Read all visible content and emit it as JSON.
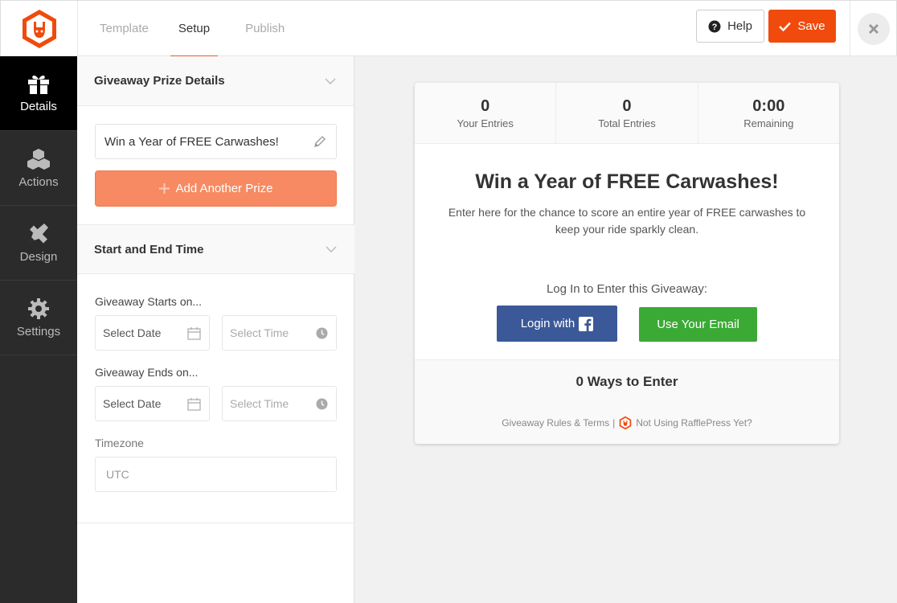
{
  "colors": {
    "brand": "#f04a0d",
    "dark_nav": "#2b2b2b",
    "facebook": "#3b5998",
    "email_green": "#3aaa35",
    "add_prize": "#f78a62"
  },
  "header": {
    "tabs": [
      {
        "label": "Template",
        "active": false
      },
      {
        "label": "Setup",
        "active": true
      },
      {
        "label": "Publish",
        "active": false
      }
    ],
    "help_label": "Help",
    "save_label": "Save"
  },
  "sidebar": {
    "items": [
      {
        "label": "Details",
        "icon": "gift-icon",
        "active": true
      },
      {
        "label": "Actions",
        "icon": "cubes-icon",
        "active": false
      },
      {
        "label": "Design",
        "icon": "pencil-ruler-icon",
        "active": false
      },
      {
        "label": "Settings",
        "icon": "gear-icon",
        "active": false
      }
    ]
  },
  "panel": {
    "prize_section_title": "Giveaway Prize Details",
    "prize_name": "Win a Year of FREE Carwashes!",
    "add_prize_label": "Add Another Prize",
    "time_section_title": "Start and End Time",
    "starts_label": "Giveaway Starts on...",
    "ends_label": "Giveaway Ends on...",
    "date_placeholder": "Select Date",
    "time_placeholder": "Select Time",
    "timezone_label": "Timezone",
    "timezone_value": "UTC"
  },
  "preview": {
    "stats": [
      {
        "value": "0",
        "label": "Your Entries"
      },
      {
        "value": "0",
        "label": "Total Entries"
      },
      {
        "value": "0:00",
        "label": "Remaining"
      }
    ],
    "title": "Win a Year of FREE Carwashes!",
    "description": "Enter here for the chance to score an entire year of FREE carwashes to keep your ride sparkly clean.",
    "login_prompt": "Log In to Enter this Giveaway:",
    "login_facebook_label": "Login with",
    "email_label": "Use Your Email",
    "ways_to_enter": "0 Ways to Enter",
    "rules_link": "Giveaway Rules & Terms",
    "separator": "|",
    "promo_link": "Not Using RafflePress Yet?"
  }
}
